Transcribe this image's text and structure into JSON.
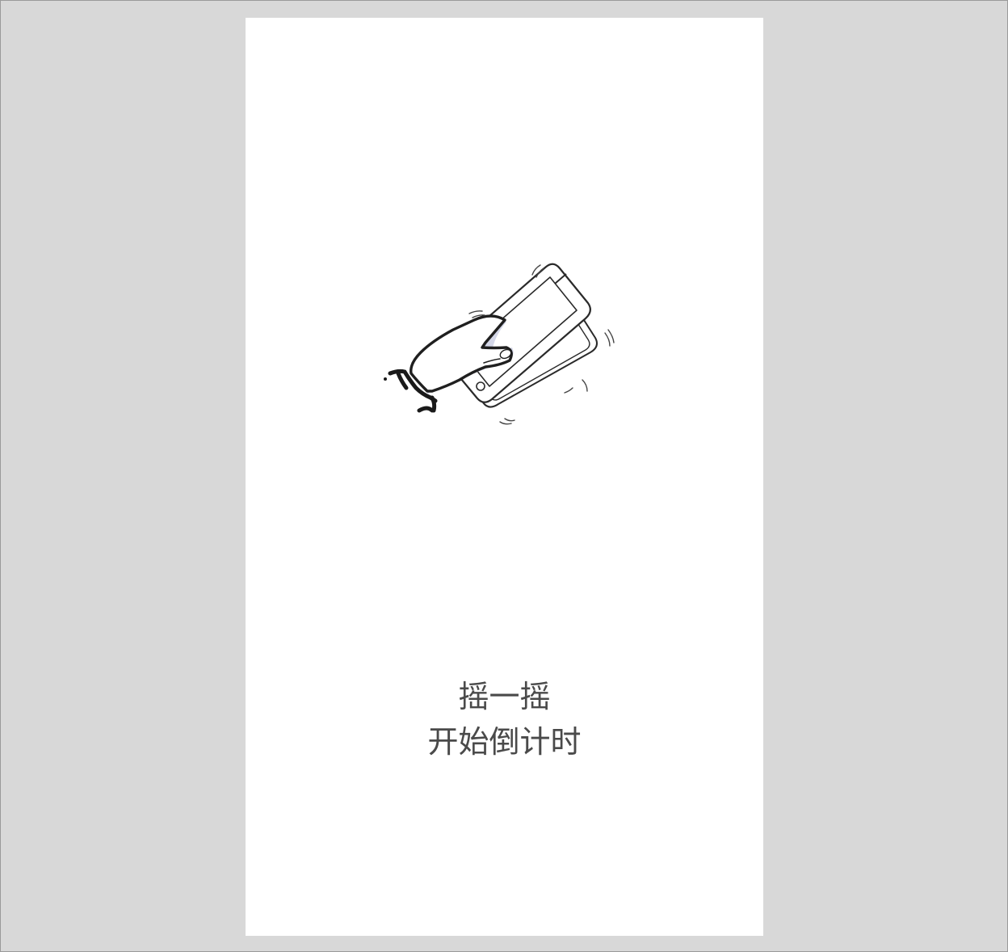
{
  "screen": {
    "illustration_icon": "shake-phone-icon",
    "caption_line1": "摇一摇",
    "caption_line2": "开始倒计时"
  },
  "colors": {
    "frame_bg": "#d8d8d8",
    "screen_bg": "#ffffff",
    "text": "#4a4a4a",
    "accent_shadow": "#c9cde0"
  }
}
